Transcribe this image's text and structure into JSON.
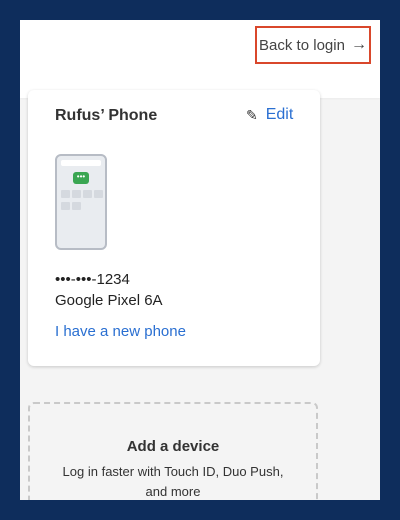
{
  "header": {
    "back_label": "Back to login",
    "back_icon": "arrow-right-icon"
  },
  "device_card": {
    "title": "Rufus’ Phone",
    "edit_label": "Edit",
    "edit_icon": "pencil-icon",
    "masked_number": "•••-•••-1234",
    "model": "Google Pixel 6A",
    "new_phone_label": "I have a new phone"
  },
  "add_device": {
    "title": "Add a device",
    "subtitle_line1": "Log in faster with Touch ID, Duo Push,",
    "subtitle_line2": "and more"
  },
  "colors": {
    "page_border": "#0e2d5c",
    "link_blue": "#2a6fd1",
    "focus_red": "#d9472b"
  }
}
